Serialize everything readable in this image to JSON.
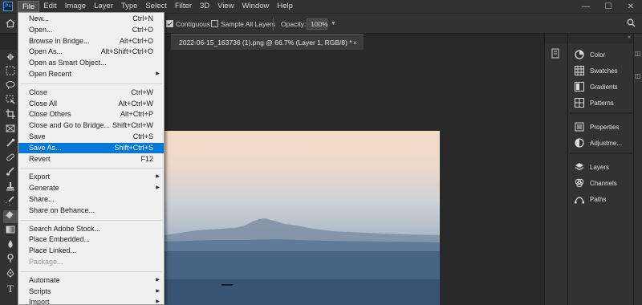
{
  "app": {
    "logo": "Ps"
  },
  "menubar": {
    "items": [
      "File",
      "Edit",
      "Image",
      "Layer",
      "Type",
      "Select",
      "Filter",
      "3D",
      "View",
      "Window",
      "Help"
    ],
    "active": "File",
    "window_controls": [
      "—",
      "☐",
      "✕"
    ]
  },
  "options": {
    "contiguous_label": "Contiguous",
    "contiguous_checked": true,
    "sample_all_label": "Sample All Layers",
    "sample_all_checked": false,
    "opacity_label": "Opacity:",
    "opacity_value": "100%"
  },
  "document": {
    "tab_title": "2022-06-15_163736 (1).png @ 66.7% (Layer 1, RGB/8) *",
    "close": "×"
  },
  "file_menu": {
    "groups": [
      [
        {
          "label": "New...",
          "shortcut": "Ctrl+N"
        },
        {
          "label": "Open...",
          "shortcut": "Ctrl+O"
        },
        {
          "label": "Browse in Bridge...",
          "shortcut": "Alt+Ctrl+O"
        },
        {
          "label": "Open As...",
          "shortcut": "Alt+Shift+Ctrl+O"
        },
        {
          "label": "Open as Smart Object...",
          "shortcut": ""
        },
        {
          "label": "Open Recent",
          "shortcut": "",
          "submenu": true
        }
      ],
      [
        {
          "label": "Close",
          "shortcut": "Ctrl+W"
        },
        {
          "label": "Close All",
          "shortcut": "Alt+Ctrl+W"
        },
        {
          "label": "Close Others",
          "shortcut": "Alt+Ctrl+P"
        },
        {
          "label": "Close and Go to Bridge...",
          "shortcut": "Shift+Ctrl+W"
        },
        {
          "label": "Save",
          "shortcut": "Ctrl+S"
        },
        {
          "label": "Save As...",
          "shortcut": "Shift+Ctrl+S",
          "highlighted": true
        },
        {
          "label": "Revert",
          "shortcut": "F12"
        }
      ],
      [
        {
          "label": "Export",
          "shortcut": "",
          "submenu": true
        },
        {
          "label": "Generate",
          "shortcut": "",
          "submenu": true
        },
        {
          "label": "Share...",
          "shortcut": ""
        },
        {
          "label": "Share on Behance...",
          "shortcut": ""
        }
      ],
      [
        {
          "label": "Search Adobe Stock...",
          "shortcut": ""
        },
        {
          "label": "Place Embedded...",
          "shortcut": ""
        },
        {
          "label": "Place Linked...",
          "shortcut": ""
        },
        {
          "label": "Package...",
          "shortcut": "",
          "disabled": true
        }
      ],
      [
        {
          "label": "Automate",
          "shortcut": "",
          "submenu": true
        },
        {
          "label": "Scripts",
          "shortcut": "",
          "submenu": true
        },
        {
          "label": "Import",
          "shortcut": "",
          "submenu": true
        }
      ]
    ]
  },
  "panels": {
    "groups": [
      [
        {
          "label": "Color",
          "icon": "color-wheel-icon"
        },
        {
          "label": "Swatches",
          "icon": "swatches-grid-icon"
        },
        {
          "label": "Gradients",
          "icon": "gradients-icon"
        },
        {
          "label": "Patterns",
          "icon": "patterns-icon"
        }
      ],
      [
        {
          "label": "Properties",
          "icon": "properties-icon"
        },
        {
          "label": "Adjustme...",
          "icon": "adjustments-icon"
        }
      ],
      [
        {
          "label": "Layers",
          "icon": "layers-icon"
        },
        {
          "label": "Channels",
          "icon": "channels-icon"
        },
        {
          "label": "Paths",
          "icon": "paths-icon"
        }
      ]
    ]
  }
}
